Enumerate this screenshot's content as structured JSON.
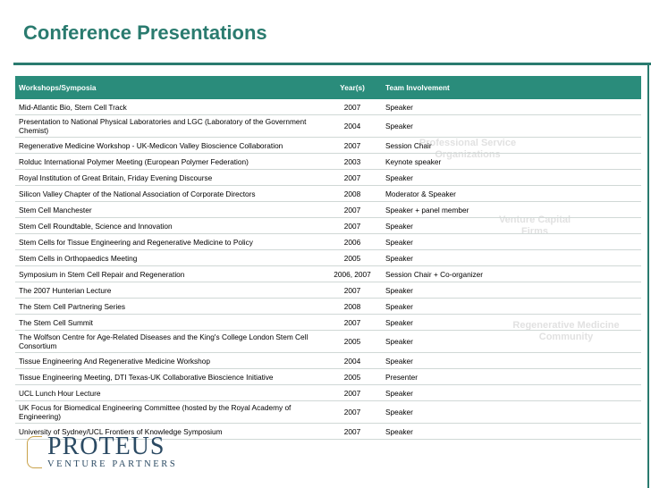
{
  "title": "Conference Presentations",
  "table": {
    "headers": [
      "Workshops/Symposia",
      "Year(s)",
      "Team Involvement"
    ],
    "rows": [
      {
        "event": "Mid-Atlantic Bio, Stem Cell Track",
        "year": "2007",
        "involvement": "Speaker",
        "tall": false
      },
      {
        "event": "Presentation to National Physical Laboratories and LGC (Laboratory of the Government Chemist)",
        "year": "2004",
        "involvement": "Speaker",
        "tall": true
      },
      {
        "event": "Regenerative Medicine Workshop - UK-Medicon Valley Bioscience Collaboration",
        "year": "2007",
        "involvement": "Session Chair",
        "tall": false
      },
      {
        "event": "Rolduc International Polymer Meeting (European Polymer Federation)",
        "year": "2003",
        "involvement": "Keynote speaker",
        "tall": false
      },
      {
        "event": "Royal Institution of Great Britain, Friday Evening Discourse",
        "year": "2007",
        "involvement": "Speaker",
        "tall": false
      },
      {
        "event": "Silicon Valley Chapter of the National Association of Corporate Directors",
        "year": "2008",
        "involvement": "Moderator & Speaker",
        "tall": false
      },
      {
        "event": "Stem Cell Manchester",
        "year": "2007",
        "involvement": "Speaker + panel member",
        "tall": false
      },
      {
        "event": "Stem Cell Roundtable, Science and Innovation",
        "year": "2007",
        "involvement": "Speaker",
        "tall": false
      },
      {
        "event": "Stem Cells for Tissue Engineering and Regenerative Medicine to Policy",
        "year": "2006",
        "involvement": "Speaker",
        "tall": false
      },
      {
        "event": "Stem Cells in Orthopaedics Meeting",
        "year": "2005",
        "involvement": "Speaker",
        "tall": false
      },
      {
        "event": "Symposium in Stem Cell Repair and Regeneration",
        "year": "2006, 2007",
        "involvement": "Session Chair + Co-organizer",
        "tall": false
      },
      {
        "event": "The 2007 Hunterian Lecture",
        "year": "2007",
        "involvement": "Speaker",
        "tall": false
      },
      {
        "event": "The Stem Cell Partnering Series",
        "year": "2008",
        "involvement": "Speaker",
        "tall": false
      },
      {
        "event": "The Stem Cell Summit",
        "year": "2007",
        "involvement": "Speaker",
        "tall": false
      },
      {
        "event": "The Wolfson Centre for Age-Related Diseases and the King's College London Stem Cell Consortium",
        "year": "2005",
        "involvement": "Speaker",
        "tall": true
      },
      {
        "event": "Tissue Engineering And Regenerative Medicine Workshop",
        "year": "2004",
        "involvement": "Speaker",
        "tall": false
      },
      {
        "event": "Tissue Engineering Meeting, DTI Texas-UK Collaborative Bioscience Initiative",
        "year": "2005",
        "involvement": "Presenter",
        "tall": false
      },
      {
        "event": "UCL Lunch Hour Lecture",
        "year": "2007",
        "involvement": "Speaker",
        "tall": false
      },
      {
        "event": "UK Focus for Biomedical Engineering Committee (hosted by the Royal Academy of Engineering)",
        "year": "2007",
        "involvement": "Speaker",
        "tall": true
      },
      {
        "event": "University of Sydney/UCL Frontiers of Knowledge Symposium",
        "year": "2007",
        "involvement": "Speaker",
        "tall": false
      }
    ]
  },
  "watermarks": [
    "Venture Capital Firms",
    "Regenerative Medicine Community",
    "Professional Service Organizations"
  ],
  "logo": {
    "main": "PROTEUS",
    "sub": "VENTURE PARTNERS"
  },
  "colors": {
    "accent": "#2a7b6f",
    "header_bg": "#2a8c7b",
    "logo": "#2b4a63",
    "logo_mark": "#c9a24a"
  }
}
